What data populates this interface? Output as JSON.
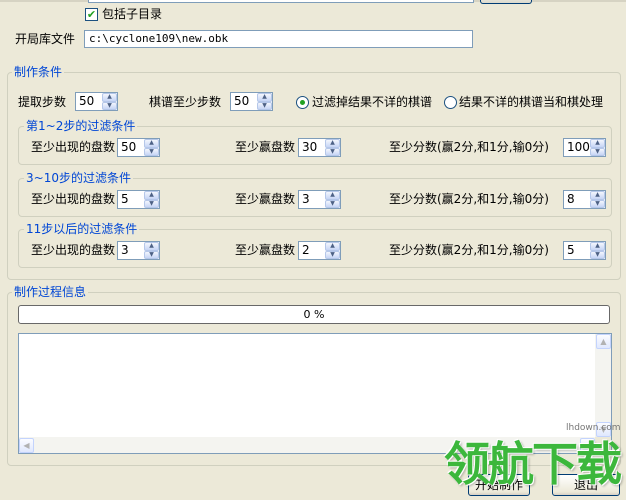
{
  "top": {
    "include_subdirs_label": "包括子目录",
    "include_subdirs_checked": true,
    "opening_lib_label": "开局库文件",
    "opening_lib_path": "c:\\cyclone109\\new.obk"
  },
  "conditions": {
    "group_title": "制作条件",
    "extract_steps_label": "提取步数",
    "extract_steps_value": "50",
    "min_steps_label": "棋谱至少步数",
    "min_steps_value": "50",
    "radio_filter_label": "过滤掉结果不详的棋谱",
    "radio_filter_selected": true,
    "radio_draw_label": "结果不详的棋谱当和棋处理",
    "radio_draw_selected": false,
    "filters": [
      {
        "title": "第1~2步的过滤条件",
        "appear_label": "至少出现的盘数",
        "appear_value": "50",
        "win_label": "至少赢盘数",
        "win_value": "30",
        "score_label": "至少分数(赢2分,和1分,输0分)",
        "score_value": "100"
      },
      {
        "title": "3~10步的过滤条件",
        "appear_label": "至少出现的盘数",
        "appear_value": "5",
        "win_label": "至少赢盘数",
        "win_value": "3",
        "score_label": "至少分数(赢2分,和1分,输0分)",
        "score_value": "8"
      },
      {
        "title": "11步以后的过滤条件",
        "appear_label": "至少出现的盘数",
        "appear_value": "3",
        "win_label": "至少赢盘数",
        "win_value": "2",
        "score_label": "至少分数(赢2分,和1分,输0分)",
        "score_value": "5"
      }
    ]
  },
  "process": {
    "group_title": "制作过程信息",
    "progress_text": "0 %",
    "progress_fraction": 0,
    "log_text": ""
  },
  "buttons": {
    "start_label": "开始制作",
    "exit_label": "退出"
  },
  "watermark": {
    "text": "领航下载",
    "url": "lhdown.com"
  },
  "colors": {
    "window_bg": "#ece9d8",
    "group_title": "#0046d5",
    "progress_fill": "#2fb42f",
    "watermark_green": "#3cb73c"
  }
}
